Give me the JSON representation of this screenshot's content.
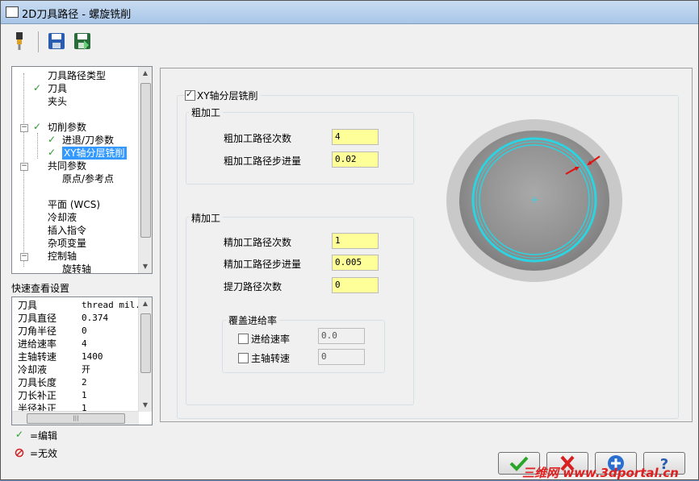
{
  "window": {
    "title": "2D刀具路径 - 螺旋铣削"
  },
  "tree": {
    "items": [
      {
        "label": "刀具路径类型",
        "checked": false
      },
      {
        "label": "刀具",
        "checked": true
      },
      {
        "label": "夹头",
        "checked": false
      },
      {
        "label": "切削参数",
        "checked": true
      },
      {
        "label": "进退/刀参数",
        "checked": true
      },
      {
        "label": "XY轴分层铣削",
        "checked": true,
        "selected": true
      },
      {
        "label": "共同参数",
        "checked": false
      },
      {
        "label": "原点/参考点",
        "checked": false
      },
      {
        "label": "平面 (WCS)",
        "checked": false
      },
      {
        "label": "冷却液",
        "checked": false
      },
      {
        "label": "插入指令",
        "checked": false
      },
      {
        "label": "杂项变量",
        "checked": false
      },
      {
        "label": "控制轴",
        "checked": false
      },
      {
        "label": "旋转轴",
        "checked": false
      }
    ]
  },
  "quick_settings": {
    "title": "快速查看设置",
    "rows": [
      {
        "key": "刀具",
        "value": "thread mil.."
      },
      {
        "key": "刀具直径",
        "value": "0.374"
      },
      {
        "key": "刀角半径",
        "value": "0"
      },
      {
        "key": "进给速率",
        "value": "4"
      },
      {
        "key": "主轴转速",
        "value": "1400"
      },
      {
        "key": "冷却液",
        "value": "开"
      },
      {
        "key": "刀具长度",
        "value": "2"
      },
      {
        "key": "刀长补正",
        "value": "1"
      },
      {
        "key": "半径补正",
        "value": "1"
      }
    ]
  },
  "legend": {
    "edit": "=编辑",
    "disabled": "=无效"
  },
  "main": {
    "xy_checkbox_label": "XY轴分层铣削",
    "xy_checked": true,
    "rough": {
      "title": "粗加工",
      "passes_label": "粗加工路径次数",
      "passes_value": "4",
      "step_label": "粗加工路径步进量",
      "step_value": "0.02"
    },
    "finish": {
      "title": "精加工",
      "passes_label": "精加工路径次数",
      "passes_value": "1",
      "step_label": "精加工路径步进量",
      "step_value": "0.005",
      "lift_label": "提刀路径次数",
      "lift_value": "0"
    },
    "override": {
      "title": "覆盖进给率",
      "feed_label": "进给速率",
      "feed_value": "0.0",
      "spindle_label": "主轴转速",
      "spindle_value": "0"
    }
  },
  "watermark": "三维网 www.3dportal.cn",
  "colors": {
    "accent_cyan": "#2cd3e0",
    "input_yellow": "#ffff99",
    "check_green": "#2c9a2c",
    "arrow_red": "#e01010"
  },
  "icons": [
    "tool-icon",
    "save-icon",
    "save-as-icon",
    "ok-icon",
    "cancel-icon",
    "add-icon",
    "help-icon"
  ]
}
